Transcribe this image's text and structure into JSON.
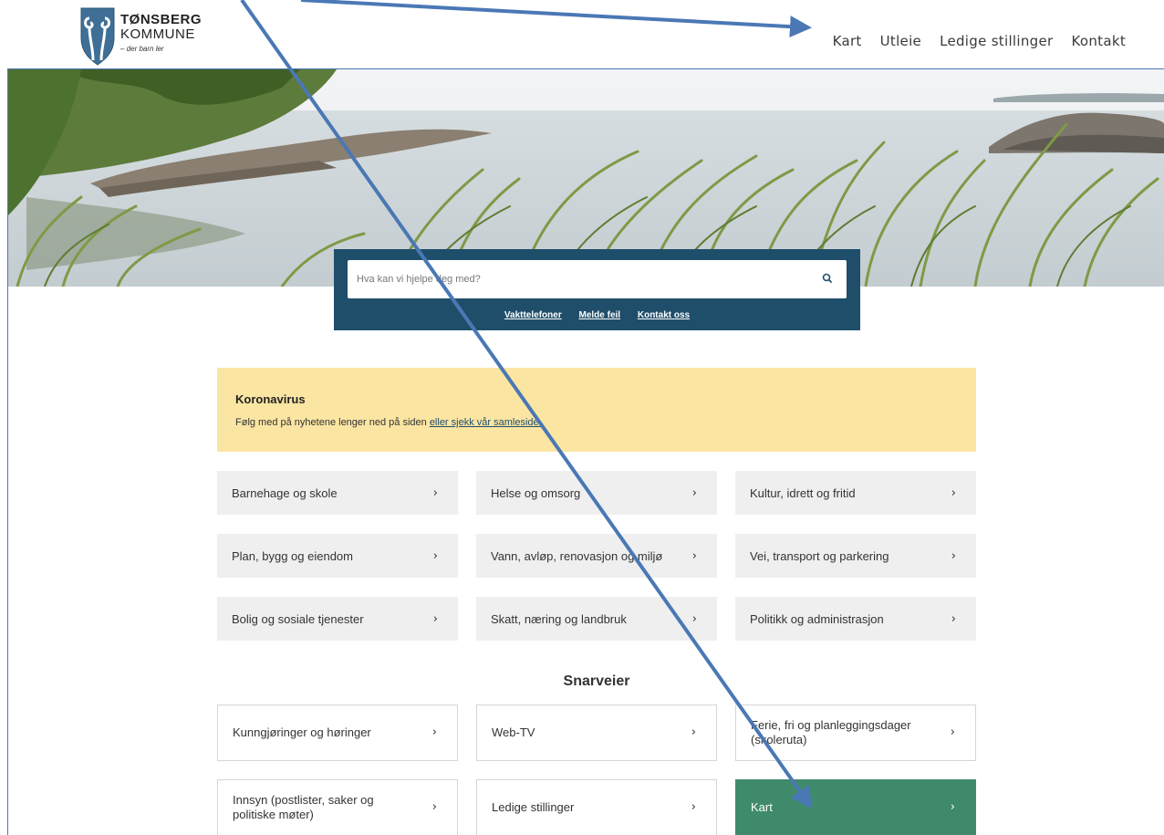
{
  "header": {
    "logo_line1": "TØNSBERG",
    "logo_line2": "KOMMUNE",
    "logo_tagline": "– der barn ler",
    "nav": [
      "Kart",
      "Utleie",
      "Ledige stillinger",
      "Kontakt"
    ]
  },
  "search": {
    "placeholder": "Hva kan vi hjelpe deg med?",
    "icon": "search-icon",
    "links": [
      "Vakttelefoner",
      "Melde feil",
      "Kontakt oss"
    ]
  },
  "notice": {
    "title": "Koronavirus",
    "text": "Følg med på nyhetene lenger ned på siden ",
    "link": "eller sjekk vår samleside."
  },
  "categories": [
    "Barnehage og skole",
    "Helse og omsorg",
    "Kultur, idrett og fritid",
    "Plan, bygg og eiendom",
    "Vann, avløp, renovasjon og miljø",
    "Vei, transport og parkering",
    "Bolig og sosiale tjenester",
    "Skatt, næring og landbruk",
    "Politikk og administrasjon"
  ],
  "shortcuts_title": "Snarveier",
  "shortcuts": [
    "Kunngjøringer og høringer",
    "Web-TV",
    "Ferie, fri og planleggingsdager (skoleruta)",
    "Innsyn (postlister, saker og politiske møter)",
    "Ledige stillinger",
    "Kart"
  ],
  "chevron": "›",
  "colors": {
    "search_panel": "#1f4e6b",
    "notice_bg": "#fbe5a3",
    "tile_bg": "#efefef",
    "active_tile": "#3f8a6a",
    "annotation_arrow": "#4a78b5"
  }
}
